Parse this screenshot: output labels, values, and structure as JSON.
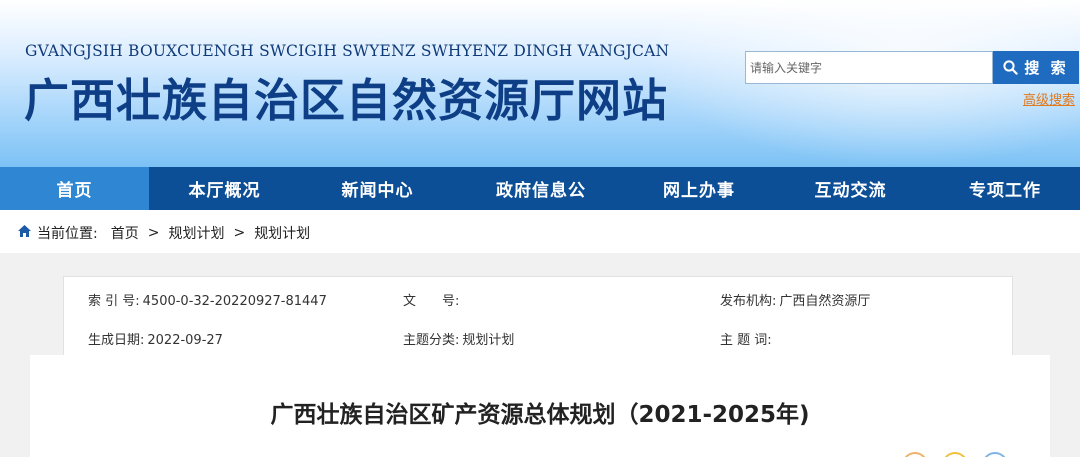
{
  "header": {
    "subtitle": "GVANGJSIH BOUXCUENGH SWCIGIH SWYENZ SWHYENZ DINGH VANGJCAN",
    "title": "广西壮族自治区自然资源厅网站",
    "search": {
      "placeholder": "请输入关键字",
      "button_label": "搜 索",
      "icon": "search-icon"
    },
    "advanced_search": "高级搜索"
  },
  "nav": {
    "items": [
      {
        "label": "首页",
        "active": true
      },
      {
        "label": "本厅概况",
        "active": false
      },
      {
        "label": "新闻中心",
        "active": false
      },
      {
        "label": "政府信息公",
        "active": false
      },
      {
        "label": "网上办事",
        "active": false
      },
      {
        "label": "互动交流",
        "active": false
      },
      {
        "label": "专项工作",
        "active": false
      }
    ]
  },
  "breadcrumb": {
    "icon": "home-icon",
    "prefix": "当前位置:",
    "items": [
      "首页",
      "规划计划",
      "规划计划"
    ],
    "separator": ">"
  },
  "info": {
    "index_label": "索 引 号:",
    "index_value": "4500-0-32-20220927-81447",
    "doc_no_label": "文　　号:",
    "doc_no_value": "",
    "publisher_label": "发布机构:",
    "publisher_value": "广西自然资源厅",
    "date_label": "生成日期:",
    "date_value": "2022-09-27",
    "category_label": "主题分类:",
    "category_value": "规划计划",
    "keywords_label": "主 题 词:",
    "keywords_value": ""
  },
  "document": {
    "title": "广西壮族自治区矿产资源总体规划（2021-2025年)"
  },
  "colors": {
    "nav_bg": "#0d4f96",
    "nav_active": "#2f86d2",
    "title": "#0e3e86",
    "search_button": "#1f6bc0",
    "advanced_link": "#e07a1e"
  }
}
